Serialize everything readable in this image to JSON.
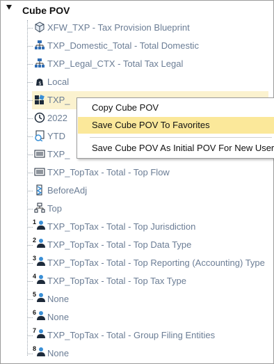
{
  "root": {
    "title": "Cube POV"
  },
  "items": [
    {
      "label": "XFW_TXP - Tax Provision Blueprint",
      "icon": "cube-icon"
    },
    {
      "label": "TXP_Domestic_Total - Total Domestic",
      "icon": "hierarchy-icon"
    },
    {
      "label": "TXP_Legal_CTX - Total Tax Legal",
      "icon": "hierarchy-icon"
    },
    {
      "label": "Local",
      "icon": "currency-icon"
    },
    {
      "label": "TXP_",
      "icon": "scenario-icon"
    },
    {
      "label": "2022",
      "icon": "clock-icon"
    },
    {
      "label": "YTD",
      "icon": "view-icon"
    },
    {
      "label": "TXP_",
      "icon": "account-icon"
    },
    {
      "label": "TXP_TopTax - Total - Top Flow",
      "icon": "flow-icon"
    },
    {
      "label": "BeforeAdj",
      "icon": "origin-icon"
    },
    {
      "label": "Top",
      "icon": "hierarchy-icon"
    },
    {
      "label": "TXP_TopTax - Total - Top Jurisdiction",
      "icon": "ud-person-icon",
      "num": "1"
    },
    {
      "label": "TXP_TopTax - Total - Top Data Type",
      "icon": "ud-person-icon",
      "num": "2"
    },
    {
      "label": "TXP_TopTax - Total - Top Reporting (Accounting) Type",
      "icon": "ud-person-icon",
      "num": "3"
    },
    {
      "label": "TXP_TopTax - Total - Top Tax Type",
      "icon": "ud-person-icon",
      "num": "4"
    },
    {
      "label": "None",
      "icon": "ud-person-icon",
      "num": "5"
    },
    {
      "label": "None",
      "icon": "ud-person-icon",
      "num": "6"
    },
    {
      "label": "TXP_TopTax - Total - Group Filing Entities",
      "icon": "ud-person-icon",
      "num": "7"
    },
    {
      "label": "None",
      "icon": "ud-person-icon",
      "num": "8"
    }
  ],
  "context_menu": {
    "items": [
      {
        "label": "Copy Cube POV"
      },
      {
        "label": "Save Cube POV To Favorites"
      },
      {
        "label": "Save Cube POV As Initial POV For New Users"
      }
    ]
  },
  "colors": {
    "highlight_row": "#fbf2cf",
    "menu_hover": "#fbe89a",
    "label": "#6b7d95",
    "ud_blue": "#3a8fd6"
  }
}
